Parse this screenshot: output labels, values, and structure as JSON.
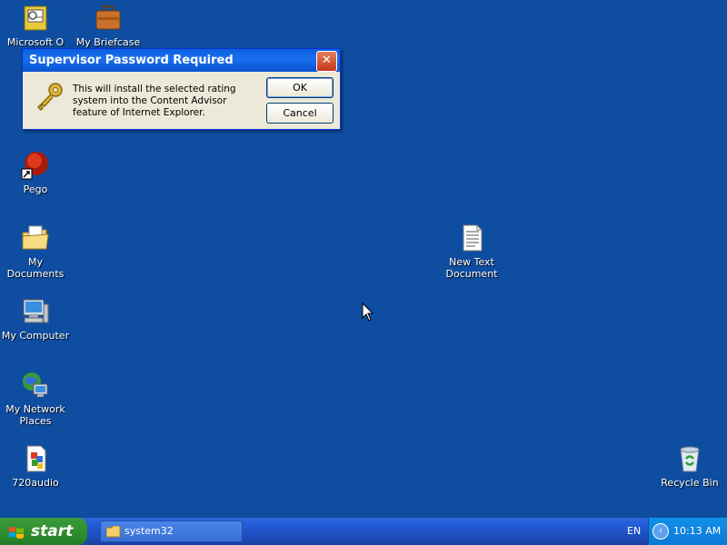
{
  "desktop_icons": [
    {
      "id": "outlook",
      "label": "Microsoft O"
    },
    {
      "id": "briefcase",
      "label": "My Briefcase"
    },
    {
      "id": "pego",
      "label": "Pego"
    },
    {
      "id": "mydocs",
      "label": "My Documents"
    },
    {
      "id": "newtext",
      "label": "New Text Document"
    },
    {
      "id": "mycomputer",
      "label": "My Computer"
    },
    {
      "id": "network",
      "label": "My Network Places"
    },
    {
      "id": "audio",
      "label": "720audio"
    },
    {
      "id": "recycle",
      "label": "Recycle Bin"
    }
  ],
  "dialog": {
    "title": "Supervisor Password Required",
    "close_label": "✕",
    "message": "This will install the selected rating system into the Content Advisor feature of Internet Explorer.",
    "ok_label": "OK",
    "cancel_label": "Cancel"
  },
  "taskbar": {
    "start_label": "start",
    "task_item_label": "system32",
    "language": "EN",
    "clock": "10:13 AM",
    "tray_arrow": "‹"
  },
  "colors": {
    "desktop": "#0f4da1",
    "taskbar": "#245edb",
    "start_green": "#2f8f2f",
    "dialog_title": "#0a5fdc"
  }
}
